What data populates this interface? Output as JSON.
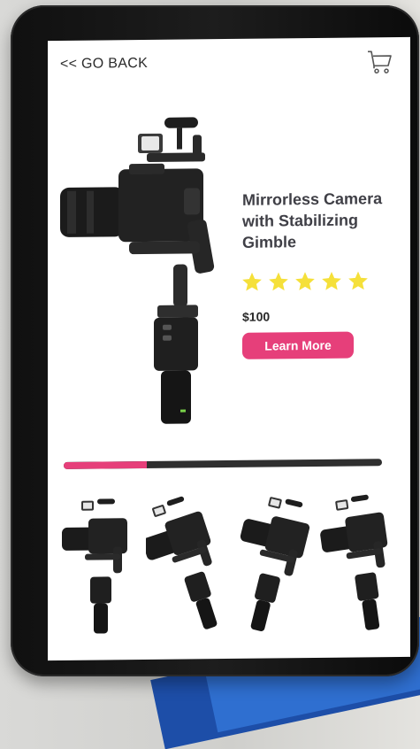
{
  "header": {
    "back_label": "<< GO BACK",
    "cart_icon": "shopping-cart-icon"
  },
  "product": {
    "title": "Mirrorless Camera with Stabilizing Gimble",
    "rating": 5,
    "rating_max": 5,
    "price": "$100",
    "cta_label": "Learn More",
    "image_icon": "camera-gimbal-image"
  },
  "carousel": {
    "progress": 0.26,
    "thumbnail_count": 4
  },
  "colors": {
    "accent": "#e63f7a",
    "star": "#f5e03a",
    "title": "#3f3f46",
    "track": "#2f2f2f"
  }
}
